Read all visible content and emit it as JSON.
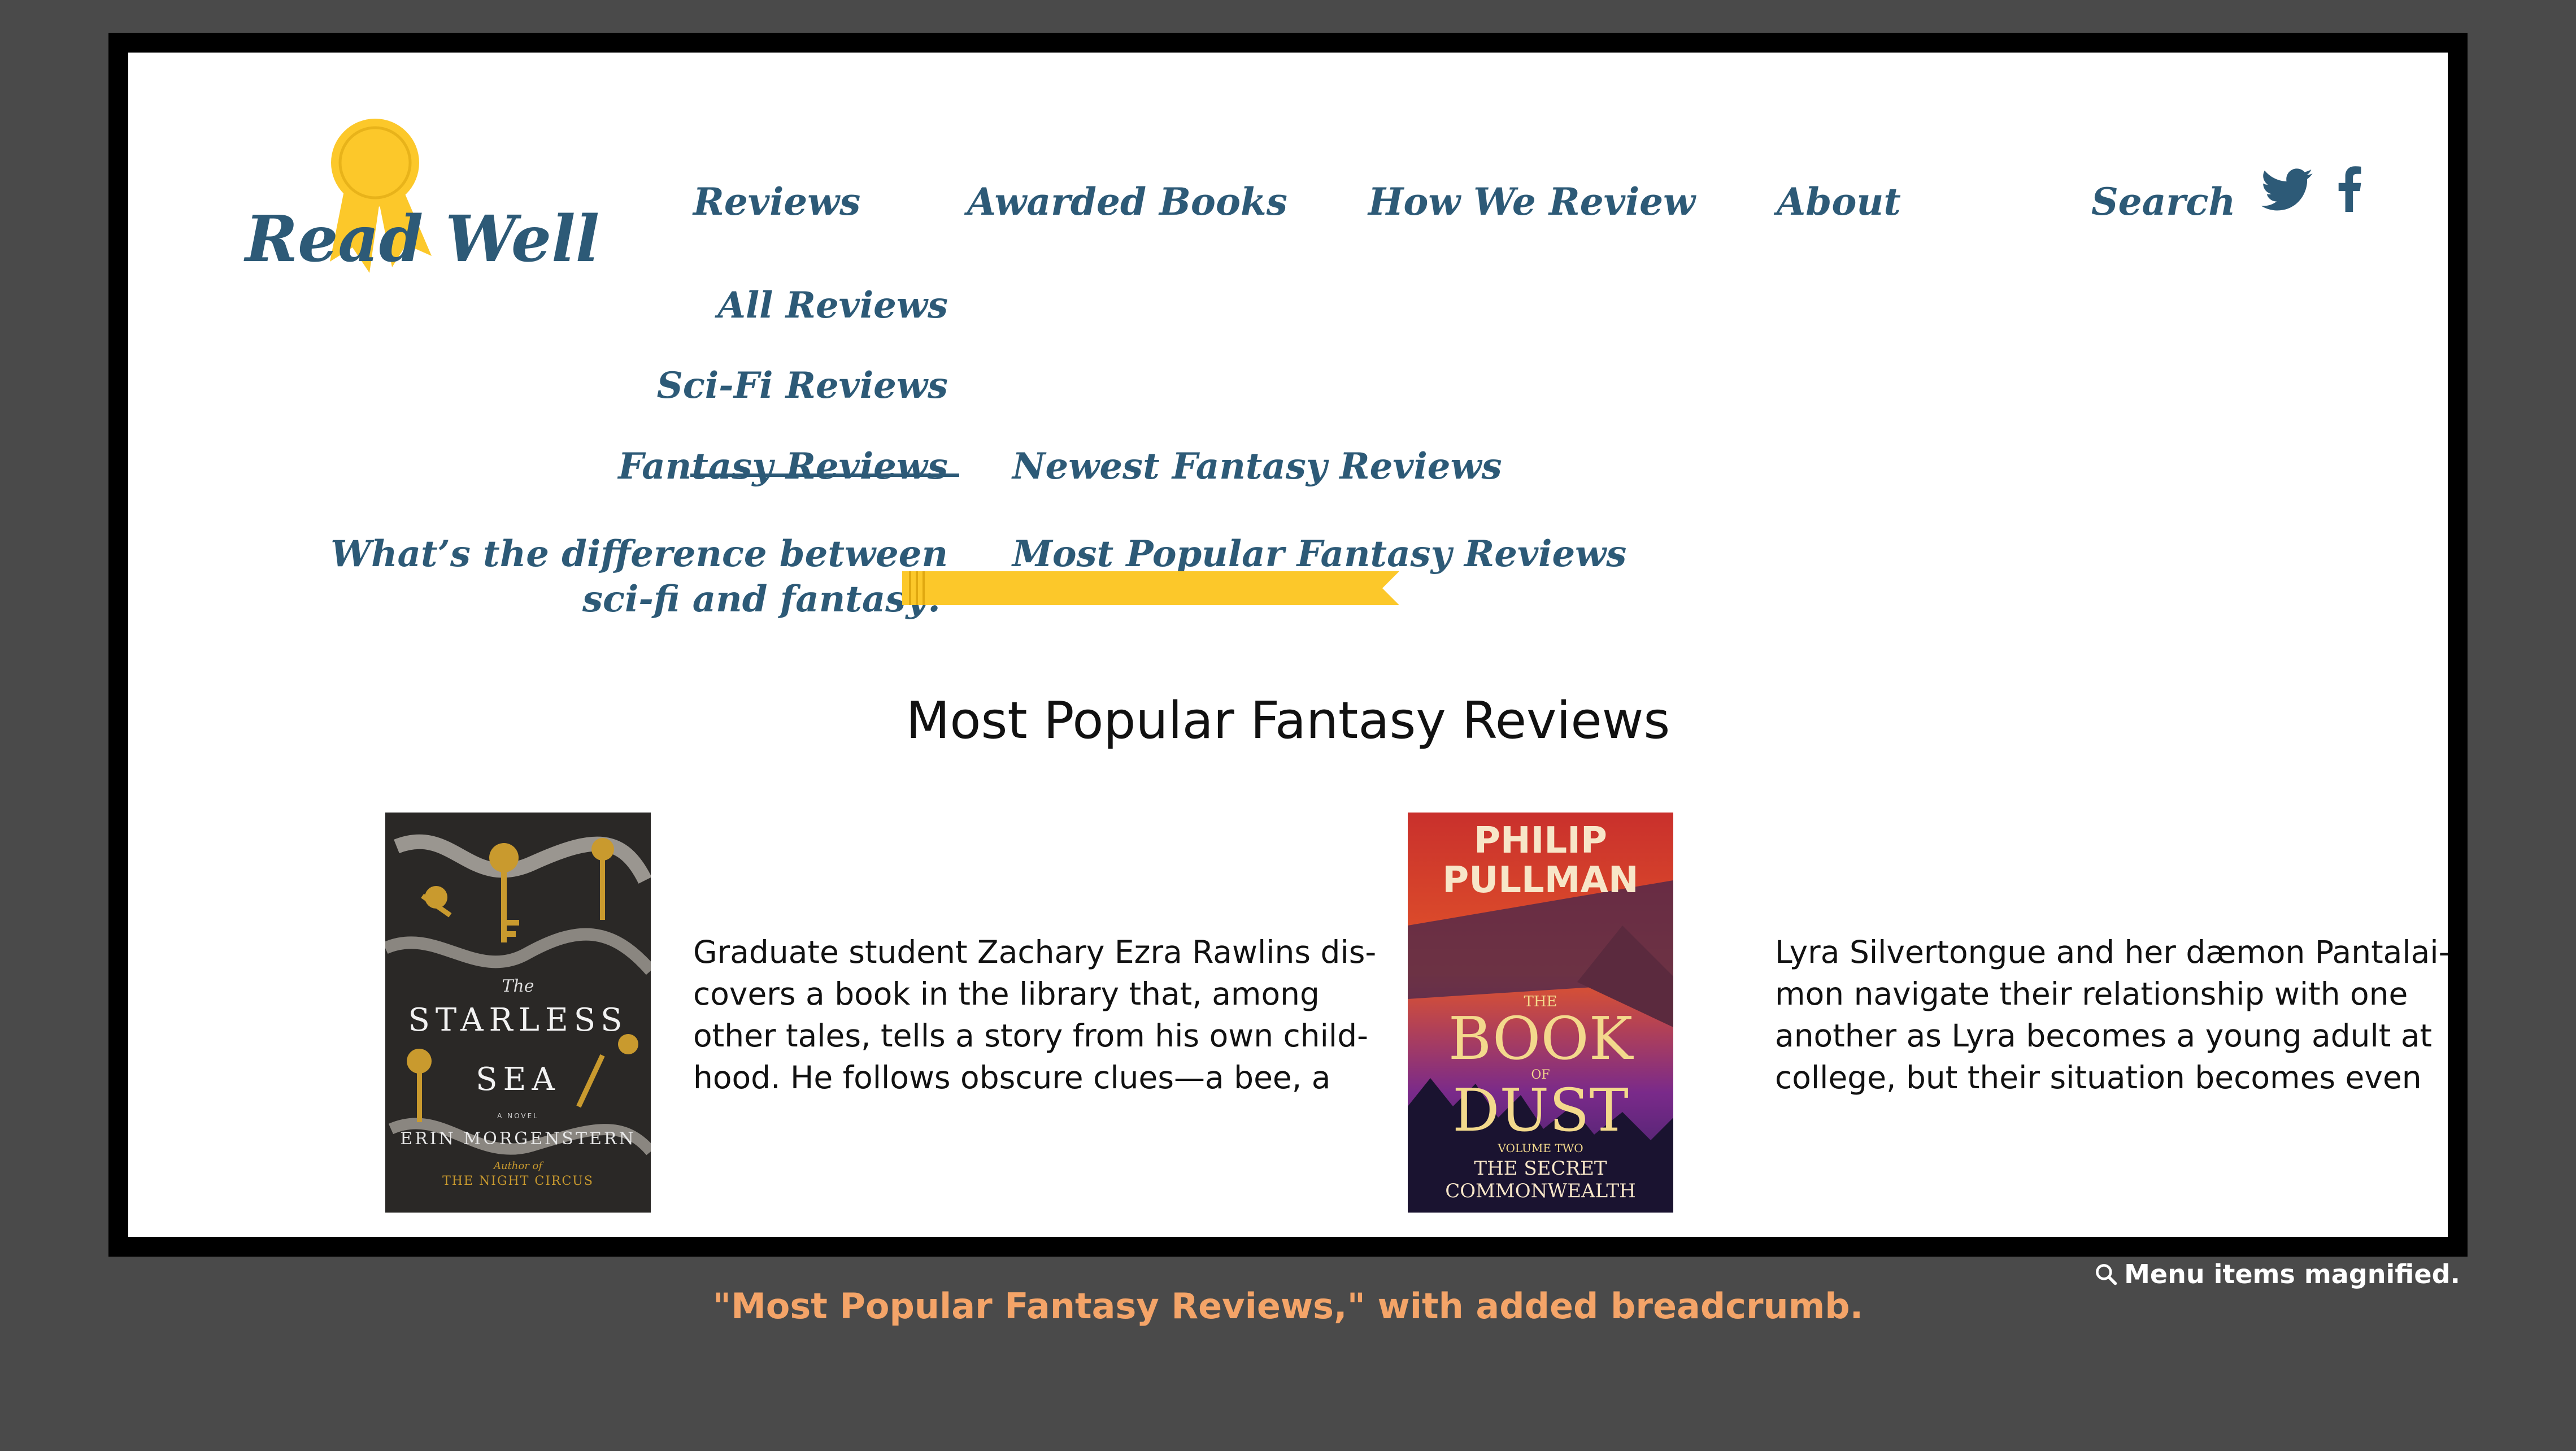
{
  "logo": {
    "text": "Read Well"
  },
  "nav": {
    "reviews": "Reviews",
    "awarded": "Awarded Books",
    "how": "How We Review",
    "about": "About",
    "search": "Search"
  },
  "social": {
    "twitter": "twitter-icon",
    "facebook": "facebook-icon"
  },
  "submenu": {
    "all": "All Reviews",
    "scifi": "Sci-Fi Reviews",
    "fantasy": "Fantasy Reviews",
    "difference_line1": "What’s the difference between",
    "difference_line2": "sci-fi and fantasy?"
  },
  "fantasy_submenu": {
    "newest": "Newest Fantasy Reviews",
    "popular": "Most Popular Fantasy Reviews"
  },
  "page_title": "Most Popular Fantasy Reviews",
  "books": [
    {
      "cover_title_small": "The",
      "cover_title_1": "STARLESS",
      "cover_title_2": "SEA",
      "cover_novel": "A NOVEL",
      "cover_author": "ERIN MORGENSTERN",
      "cover_author_of": "Author of",
      "cover_other": "THE NIGHT CIRCUS",
      "desc_lines": [
        "Graduate student Zachary Ezra Rawlins dis-",
        "covers a book in the library that, among",
        "other tales, tells a story from his own child-",
        "hood. He follows obscure clues—a bee, a"
      ]
    },
    {
      "cover_author_1": "PHILIP",
      "cover_author_2": "PULLMAN",
      "cover_the": "THE",
      "cover_book": "BOOK",
      "cover_of": "OF",
      "cover_dust": "DUST",
      "cover_volume": "VOLUME TWO",
      "cover_sub_1": "THE SECRET",
      "cover_sub_2": "COMMONWEALTH",
      "desc_lines": [
        "Lyra Silvertongue and her dæmon Pantalai-",
        "mon navigate their relationship with one",
        "another as Lyra becomes a young adult at",
        "college, but their situation becomes even"
      ]
    }
  ],
  "annotations": {
    "note": "Menu items magnified.",
    "caption": "\"Most Popular Fantasy Reviews,\" with added breadcrumb."
  },
  "colors": {
    "nav": "#2d5a77",
    "accent": "#fcc82a",
    "caption": "#f4a468"
  }
}
